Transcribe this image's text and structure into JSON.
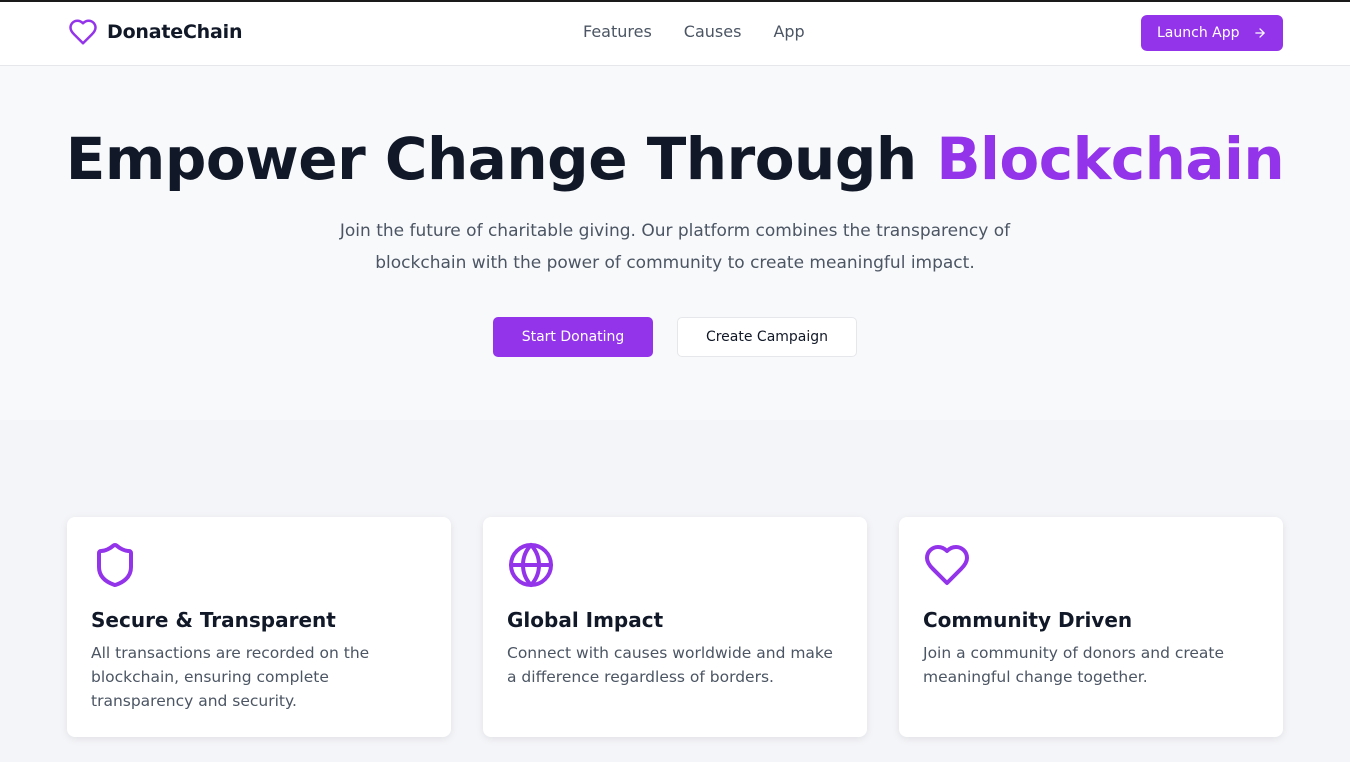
{
  "brand": {
    "name": "DonateChain",
    "accent": "#9333ea"
  },
  "nav": {
    "items": [
      "Features",
      "Causes",
      "App"
    ]
  },
  "header": {
    "launch_label": "Launch App"
  },
  "hero": {
    "title_main": "Empower Change Through ",
    "title_accent": "Blockchain",
    "subtitle": "Join the future of charitable giving. Our platform combines the transparency of blockchain with the power of community to create meaningful impact.",
    "primary_button": "Start Donating",
    "secondary_button": "Create Campaign"
  },
  "features": [
    {
      "icon": "shield-icon",
      "title": "Secure & Transparent",
      "description": "All transactions are recorded on the blockchain, ensuring complete transparency and security."
    },
    {
      "icon": "globe-icon",
      "title": "Global Impact",
      "description": "Connect with causes worldwide and make a difference regardless of borders."
    },
    {
      "icon": "heart-icon",
      "title": "Community Driven",
      "description": "Join a community of donors and create meaningful change together."
    }
  ]
}
